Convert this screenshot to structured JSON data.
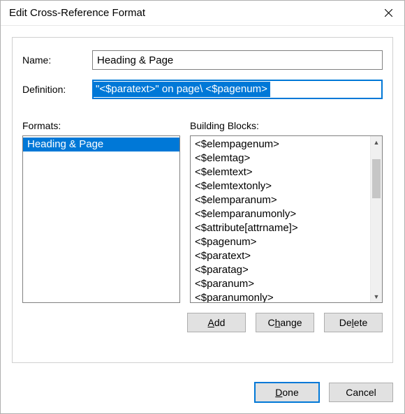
{
  "window": {
    "title": "Edit Cross-Reference Format"
  },
  "labels": {
    "name": "Name:",
    "definition": "Definition:",
    "formats": "Formats:",
    "buildingBlocks": "Building Blocks:"
  },
  "fields": {
    "name": "Heading & Page",
    "definition": "\"<$paratext>\" on page\\ <$pagenum>"
  },
  "formats": {
    "items": [
      "Heading & Page"
    ],
    "selectedIndex": 0
  },
  "buildingBlocks": {
    "items": [
      "<$elempagenum>",
      "<$elemtag>",
      "<$elemtext>",
      "<$elemtextonly>",
      "<$elemparanum>",
      "<$elemparanumonly>",
      "<$attribute[attrname]>",
      "<$pagenum>",
      "<$paratext>",
      "<$paratag>",
      "<$paranum>",
      "<$paranumonly>"
    ]
  },
  "buttons": {
    "add": {
      "pre": "",
      "key": "A",
      "post": "dd"
    },
    "change": {
      "pre": "C",
      "key": "h",
      "post": "ange"
    },
    "delete": {
      "pre": "De",
      "key": "l",
      "post": "ete"
    },
    "done": {
      "pre": "",
      "key": "D",
      "post": "one"
    },
    "cancel": "Cancel"
  }
}
